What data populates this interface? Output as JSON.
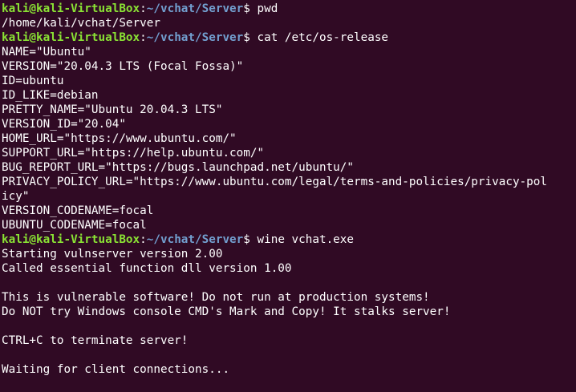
{
  "terminal": {
    "background_color": "#300a24",
    "prompt": {
      "user_host": "kali@kali-VirtualBox",
      "separator": ":",
      "path": "~/vchat/Server",
      "symbol": "$ ",
      "user_color": "#8ae234",
      "path_color": "#729fcf"
    },
    "commands": {
      "pwd": "pwd",
      "cat": "cat /etc/os-release",
      "wine": "wine vchat.exe"
    },
    "output": {
      "pwd": "/home/kali/vchat/Server",
      "os_release": [
        "NAME=\"Ubuntu\"",
        "VERSION=\"20.04.3 LTS (Focal Fossa)\"",
        "ID=ubuntu",
        "ID_LIKE=debian",
        "PRETTY_NAME=\"Ubuntu 20.04.3 LTS\"",
        "VERSION_ID=\"20.04\"",
        "HOME_URL=\"https://www.ubuntu.com/\"",
        "SUPPORT_URL=\"https://help.ubuntu.com/\"",
        "BUG_REPORT_URL=\"https://bugs.launchpad.net/ubuntu/\"",
        "PRIVACY_POLICY_URL=\"https://www.ubuntu.com/legal/terms-and-policies/privacy-pol",
        "icy\"",
        "VERSION_CODENAME=focal",
        "UBUNTU_CODENAME=focal"
      ],
      "vchat": {
        "l1": "Starting vulnserver version 2.00",
        "l2": "Called essential function dll version 1.00",
        "l3": "This is vulnerable software! Do not run at production systems!",
        "l4": "Do NOT try Windows console CMD's Mark and Copy! It stalks server!",
        "l5": "CTRL+C to terminate server!",
        "l6": "Waiting for client connections..."
      }
    }
  }
}
